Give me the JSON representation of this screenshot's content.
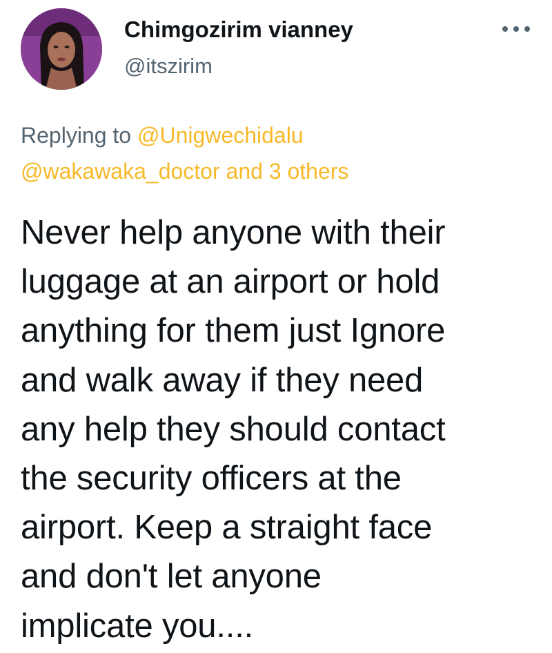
{
  "author": {
    "name": "Chimgozirim vianney",
    "handle": "@itszirim"
  },
  "icons": {
    "more": "more-horizontal-icon",
    "avatar": "profile-photo"
  },
  "reply": {
    "prefix": "Replying to",
    "mention_1": "@Unigwechidalu",
    "mention_2": "@wakawaka_doctor",
    "others": "and 3 others"
  },
  "tweet": {
    "text": "Never help anyone with their\nluggage at an airport or hold\nanything for them just Ignore\nand walk away if they need\nany help they should contact\nthe security officers at the\nairport.  Keep a straight face\nand don't let anyone\nimplicate you...."
  },
  "colors": {
    "mention": "#f7b928",
    "secondary_text": "#536471",
    "primary_text": "#0f1419",
    "background": "#ffffff"
  }
}
